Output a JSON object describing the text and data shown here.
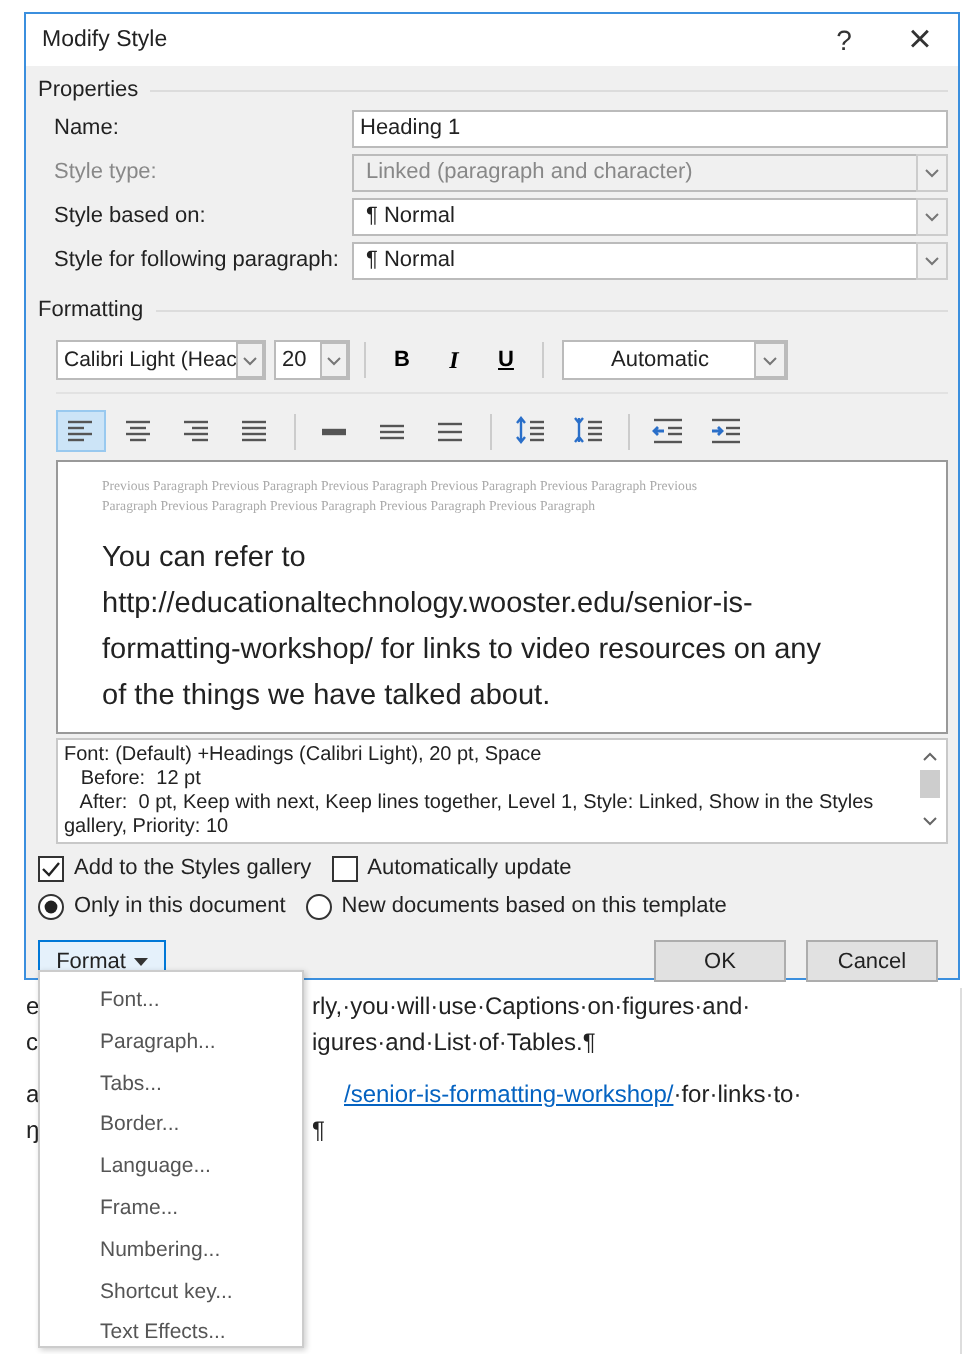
{
  "dialog": {
    "title": "Modify Style",
    "help_button": "?",
    "close_button": "×"
  },
  "properties": {
    "heading": "Properties",
    "fields": [
      {
        "label": "Name:",
        "value": "Heading 1",
        "kind": "text",
        "disabled": false
      },
      {
        "label": "Style type:",
        "value": "Linked (paragraph and character)",
        "kind": "dropdown",
        "disabled": true
      },
      {
        "label": "Style based on:",
        "value": "¶ Normal",
        "kind": "dropdown",
        "disabled": false
      },
      {
        "label": "Style for following paragraph:",
        "value": "¶ Normal",
        "kind": "dropdown",
        "disabled": false
      }
    ]
  },
  "formatting": {
    "heading": "Formatting",
    "font": "Calibri Light (Heac",
    "size": "20",
    "bold": "B",
    "italic": "I",
    "underline": "U",
    "color_name": "Automatic",
    "paragraph_buttons": [
      {
        "kind": "align-left",
        "selected": true
      },
      {
        "kind": "align-center",
        "selected": false
      },
      {
        "kind": "align-right",
        "selected": false
      },
      {
        "kind": "justify",
        "selected": false
      },
      {
        "kind": "separator"
      },
      {
        "kind": "single-spacing",
        "selected": false
      },
      {
        "kind": "one-half-spacing",
        "selected": false
      },
      {
        "kind": "double-spacing",
        "selected": false
      },
      {
        "kind": "separator"
      },
      {
        "kind": "space-up",
        "selected": false
      },
      {
        "kind": "space-down",
        "selected": false
      },
      {
        "kind": "separator"
      },
      {
        "kind": "indent-decrease",
        "selected": false
      },
      {
        "kind": "indent-increase",
        "selected": false
      }
    ]
  },
  "preview": {
    "previous_lines": [
      "Previous Paragraph Previous Paragraph Previous Paragraph Previous Paragraph Previous Paragraph Previous",
      "Paragraph Previous Paragraph Previous Paragraph Previous Paragraph Previous Paragraph"
    ],
    "sample_lines": [
      "You can refer to",
      "http://educationaltechnology.wooster.edu/senior-is-",
      "formatting-workshop/ for links to video resources on any",
      "of the things we have talked about."
    ]
  },
  "description_lines": [
    "Font: (Default) +Headings (Calibri Light), 20 pt, Space",
    "   Before:  12 pt",
    "   After:  0 pt, Keep with next, Keep lines together, Level 1, Style: Linked, Show in the Styles",
    "gallery, Priority: 10"
  ],
  "checkboxes": [
    {
      "label": "Add to the Styles gallery",
      "checked": true
    },
    {
      "label": "Automatically update",
      "checked": false
    }
  ],
  "radios": [
    {
      "label": "Only in this document",
      "selected": true
    },
    {
      "label": "New documents based on this template",
      "selected": false
    }
  ],
  "buttons": {
    "format": "Format",
    "ok": "OK",
    "cancel": "Cancel"
  },
  "format_menu": [
    "Font...",
    "Paragraph...",
    "Tabs...",
    "Border...",
    "Language...",
    "Frame...",
    "Numbering...",
    "Shortcut key...",
    "Text Effects..."
  ],
  "document": {
    "lines": [
      {
        "left": "e",
        "right": "rly,·you·will·use·Captions·on·figures·and·"
      },
      {
        "left": "c",
        "right": "igures·and·List·of·Tables.¶"
      },
      {
        "left": "a",
        "link": "/senior-is-formatting-workshop/",
        "right": "·for·links·to·"
      },
      {
        "left": "ŋ",
        "right": "¶"
      }
    ]
  }
}
